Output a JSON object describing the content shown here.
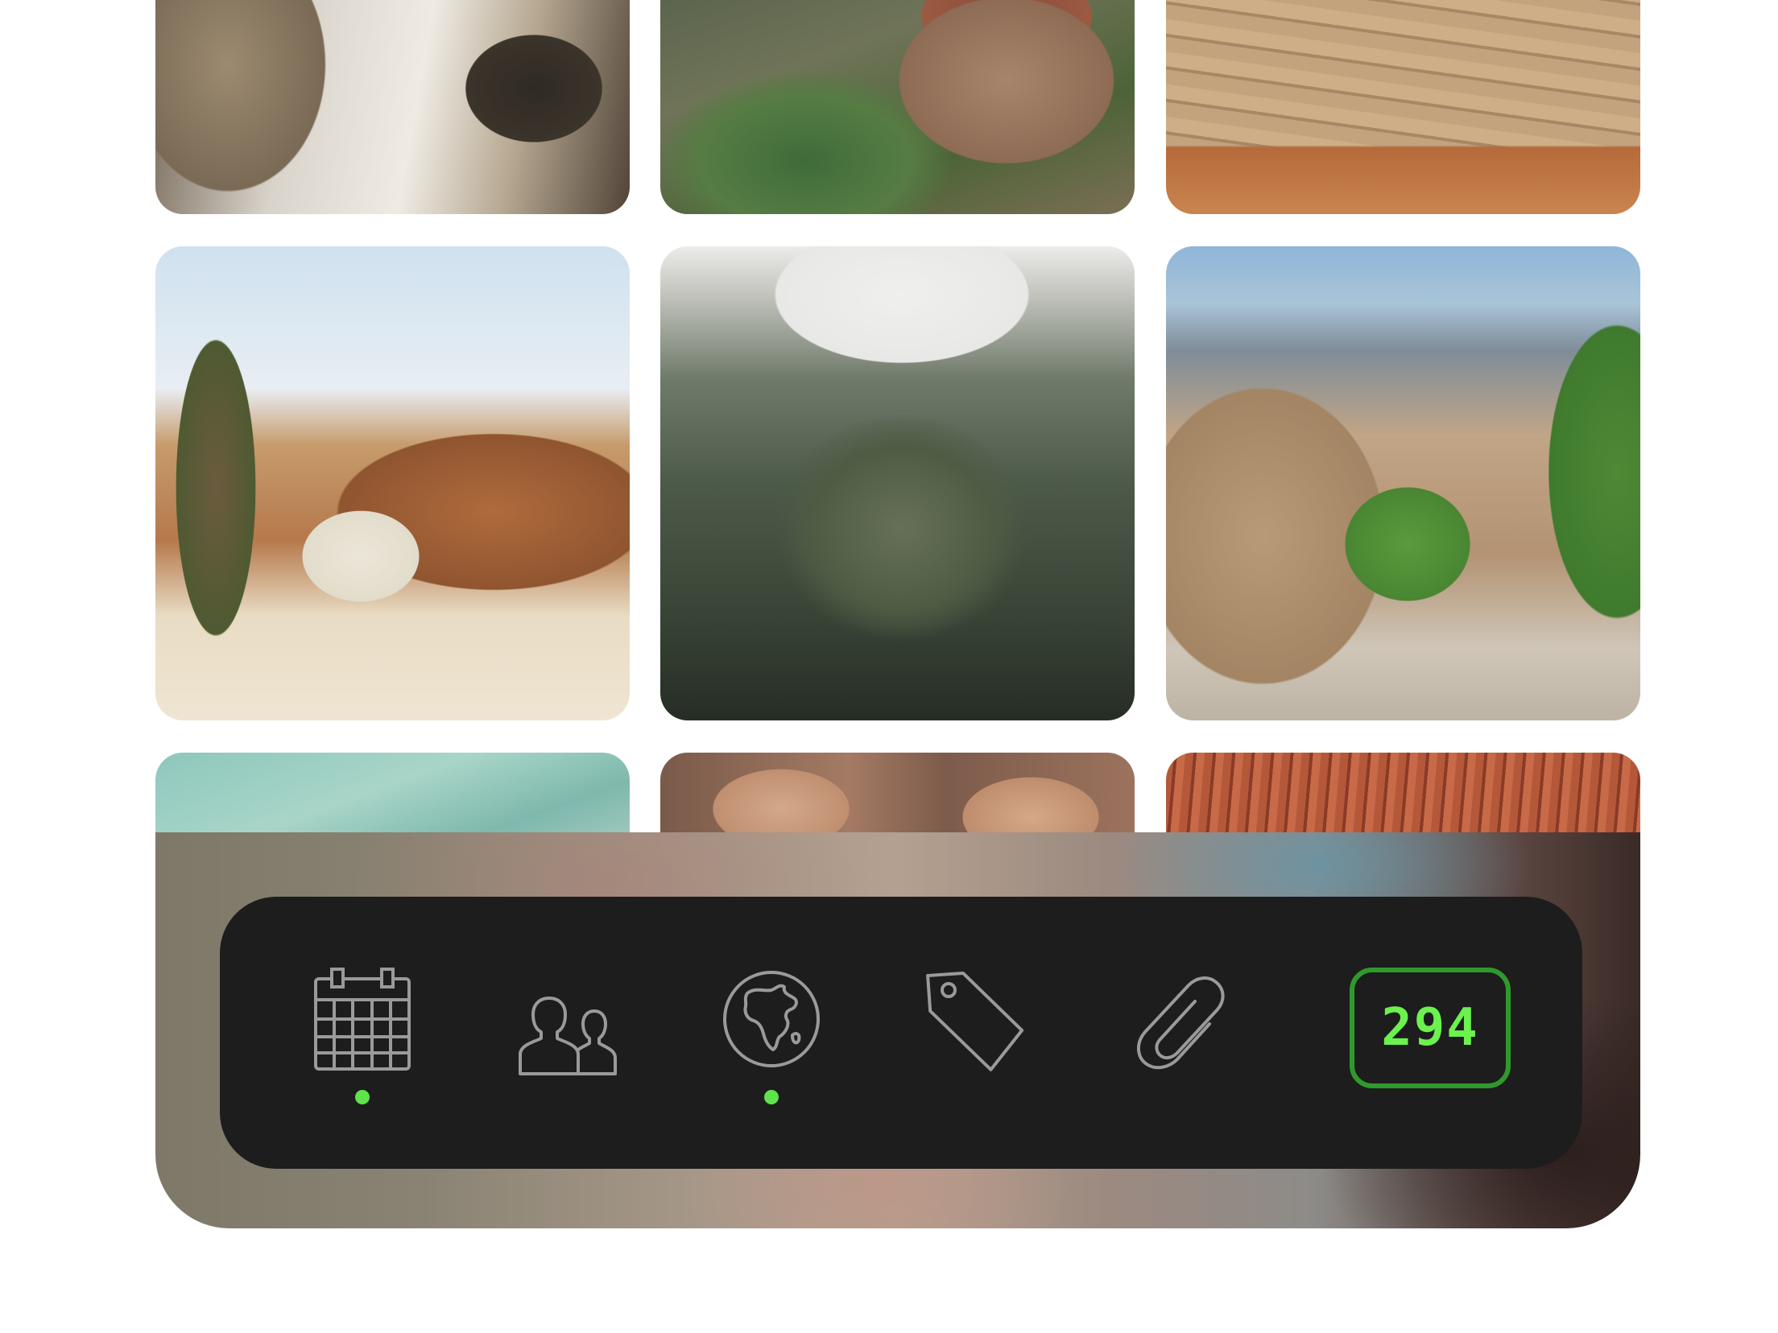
{
  "toolbar": {
    "items": [
      {
        "name": "calendar-icon",
        "active": true
      },
      {
        "name": "people-icon",
        "active": false
      },
      {
        "name": "globe-icon",
        "active": true
      },
      {
        "name": "tag-icon",
        "active": false
      },
      {
        "name": "paperclip-icon",
        "active": false
      }
    ],
    "count": "294"
  },
  "colors": {
    "accent": "#5ee34a",
    "badge_border": "#2f9a2b",
    "dock_background": "#1d1d1d",
    "icon_stroke": "#9a9a9a"
  }
}
